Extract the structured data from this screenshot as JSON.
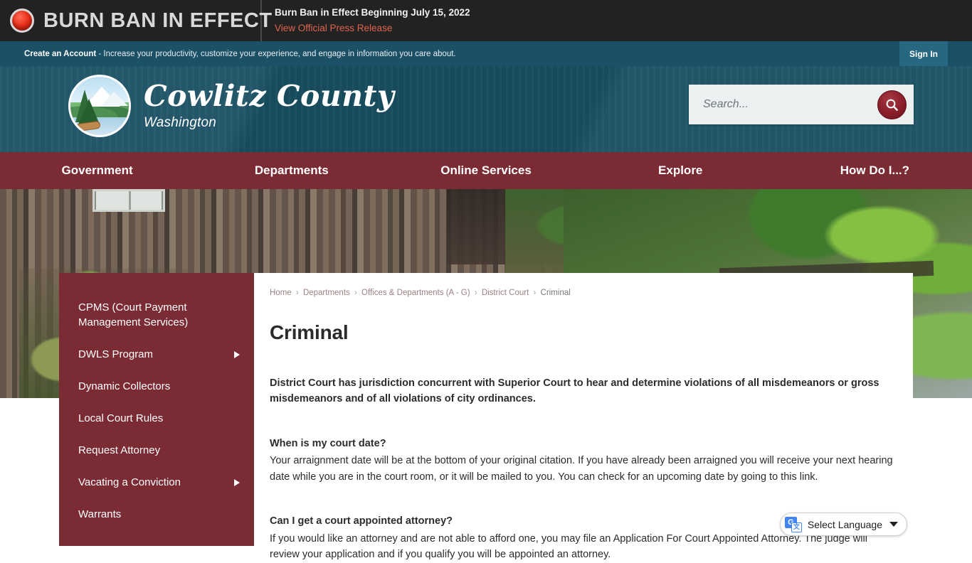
{
  "alert": {
    "icon": "red-alert-dot-icon",
    "banner_title": "BURN BAN IN EFFECT",
    "headline": "Burn Ban in Effect Beginning July 15, 2022",
    "link_label": "View Official Press Release"
  },
  "account_bar": {
    "cta_bold": "Create an Account",
    "cta_rest": " - Increase your productivity, customize your experience, and engage in information you care about.",
    "sign_in_label": "Sign In"
  },
  "header": {
    "seal_icon": "cowlitz-county-seal-icon",
    "brand_name": "Cowlitz County",
    "brand_sub": "Washington",
    "search_placeholder": "Search...",
    "search_value": "",
    "search_icon": "search-icon",
    "colors": {
      "header_teal": "#1a5164",
      "account_teal": "#1b5066",
      "nav_maroon": "#7b2b33",
      "search_button_red": "#8a1f2b",
      "alert_bar_dark": "#222222",
      "alert_link_red": "#e0634f"
    }
  },
  "nav": {
    "items": [
      {
        "label": "Government"
      },
      {
        "label": "Departments"
      },
      {
        "label": "Online Services"
      },
      {
        "label": "Explore"
      },
      {
        "label": "How Do I...?"
      }
    ]
  },
  "sidebar": {
    "items": [
      {
        "label": "CPMS (Court Payment Management Services)",
        "has_submenu": false
      },
      {
        "label": "DWLS Program",
        "has_submenu": true
      },
      {
        "label": "Dynamic Collectors",
        "has_submenu": false
      },
      {
        "label": "Local Court Rules",
        "has_submenu": false
      },
      {
        "label": "Request Attorney",
        "has_submenu": false
      },
      {
        "label": "Vacating a Conviction",
        "has_submenu": true
      },
      {
        "label": "Warrants",
        "has_submenu": false
      }
    ]
  },
  "breadcrumb": {
    "items": [
      {
        "label": "Home"
      },
      {
        "label": "Departments"
      },
      {
        "label": "Offices & Departments (A - G)"
      },
      {
        "label": "District Court"
      }
    ],
    "current": "Criminal",
    "separator": "›"
  },
  "main": {
    "page_title": "Criminal",
    "lead": " District Court has jurisdiction concurrent with Superior Court to hear and determine violations of all misdemeanors or gross misdemeanors and of all violations of city ordinances.",
    "faq": [
      {
        "question": " When is my court date?",
        "answer": "Your arraignment date will be at the bottom of your original citation. If you have already been arraigned you will receive your next hearing date while you are in the court room, or it will be mailed to you. You can check for an upcoming date by going to this link."
      },
      {
        "question": "Can I get a court appointed attorney?",
        "answer": "If you would like an attorney and are not able to afford one, you may file an Application For Court Appointed Attorney. The judge will review your application and if you qualify you will be appointed an attorney."
      }
    ]
  },
  "translate": {
    "icon": "google-translate-icon",
    "label": "Select Language",
    "caret_icon": "chevron-down-icon"
  }
}
